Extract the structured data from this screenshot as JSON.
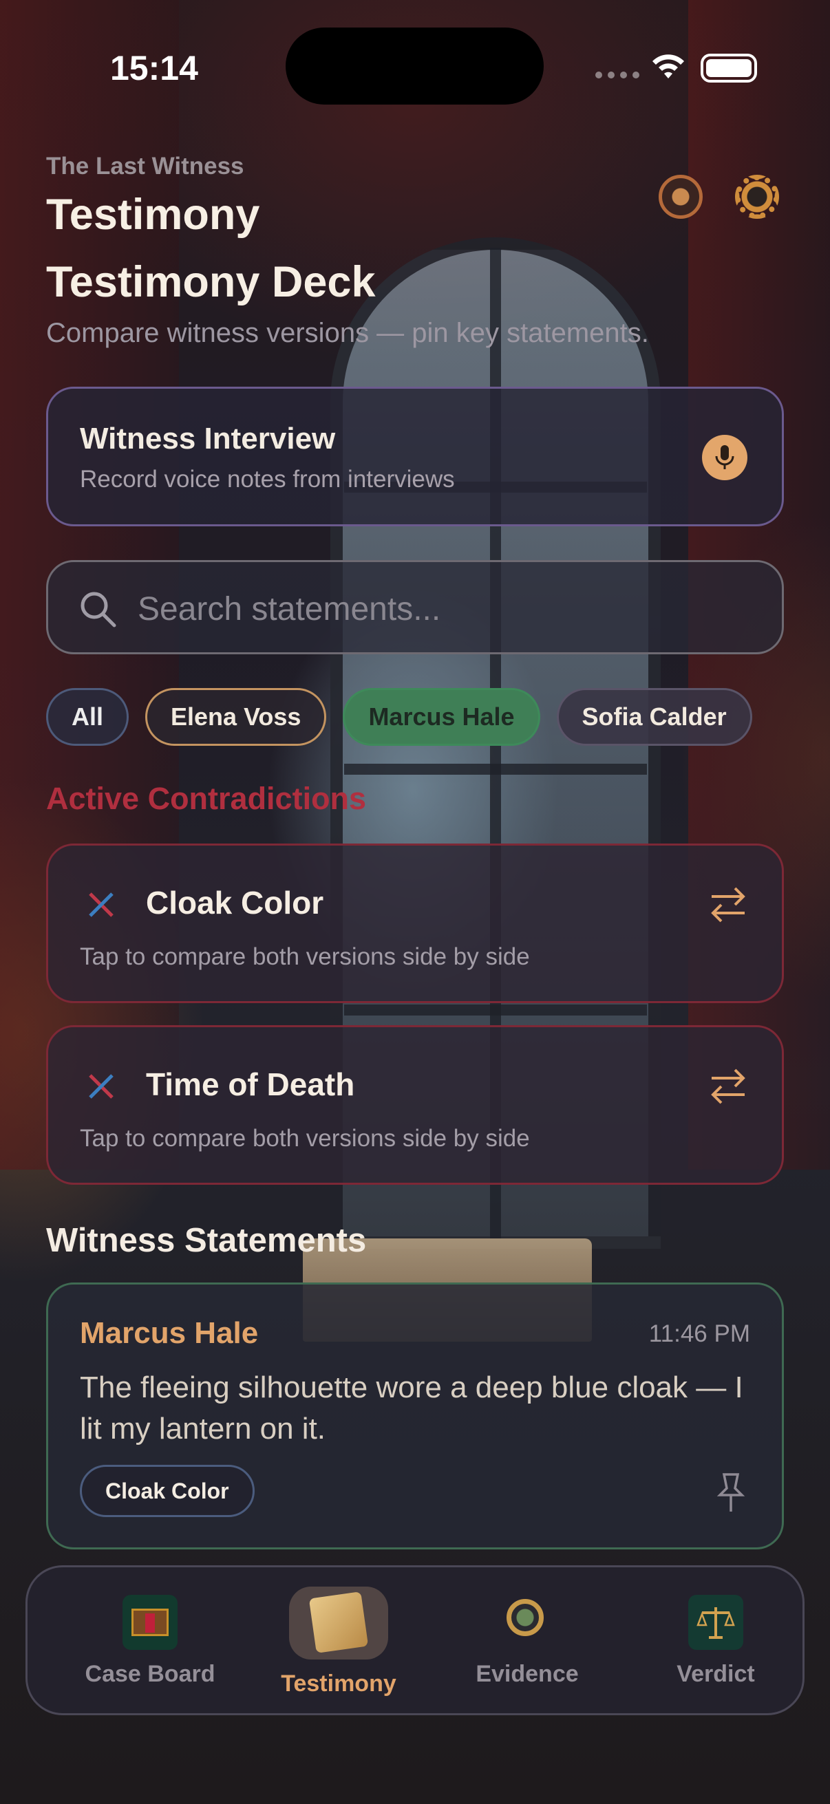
{
  "status_bar": {
    "time": "15:14"
  },
  "header": {
    "eyebrow": "The Last Witness",
    "title": "Testimony",
    "subtitle_title": "Testimony Deck",
    "description": "Compare witness versions — pin key statements."
  },
  "interview_card": {
    "title": "Witness Interview",
    "subtitle": "Record voice notes from interviews"
  },
  "search": {
    "placeholder": "Search statements..."
  },
  "filters": [
    "All",
    "Elena Voss",
    "Marcus Hale",
    "Sofia Calder"
  ],
  "selected_filter": "Marcus Hale",
  "contradictions": {
    "heading": "Active Contradictions",
    "items": [
      {
        "title": "Cloak Color",
        "hint": "Tap to compare both versions side by side"
      },
      {
        "title": "Time of Death",
        "hint": "Tap to compare both versions side by side"
      }
    ]
  },
  "statements": {
    "heading": "Witness Statements",
    "items": [
      {
        "witness": "Marcus Hale",
        "time": "11:46 PM",
        "text": "The fleeing silhouette wore a deep blue cloak — I lit my lantern on it.",
        "tag": "Cloak Color"
      }
    ]
  },
  "tabs": {
    "items": [
      {
        "label": "Case Board"
      },
      {
        "label": "Testimony"
      },
      {
        "label": "Evidence"
      },
      {
        "label": "Verdict"
      }
    ],
    "active": "Testimony"
  },
  "colors": {
    "accent": "#e2a46a",
    "contradiction": "#b02f3f",
    "selected_chip": "#3f7f56"
  }
}
